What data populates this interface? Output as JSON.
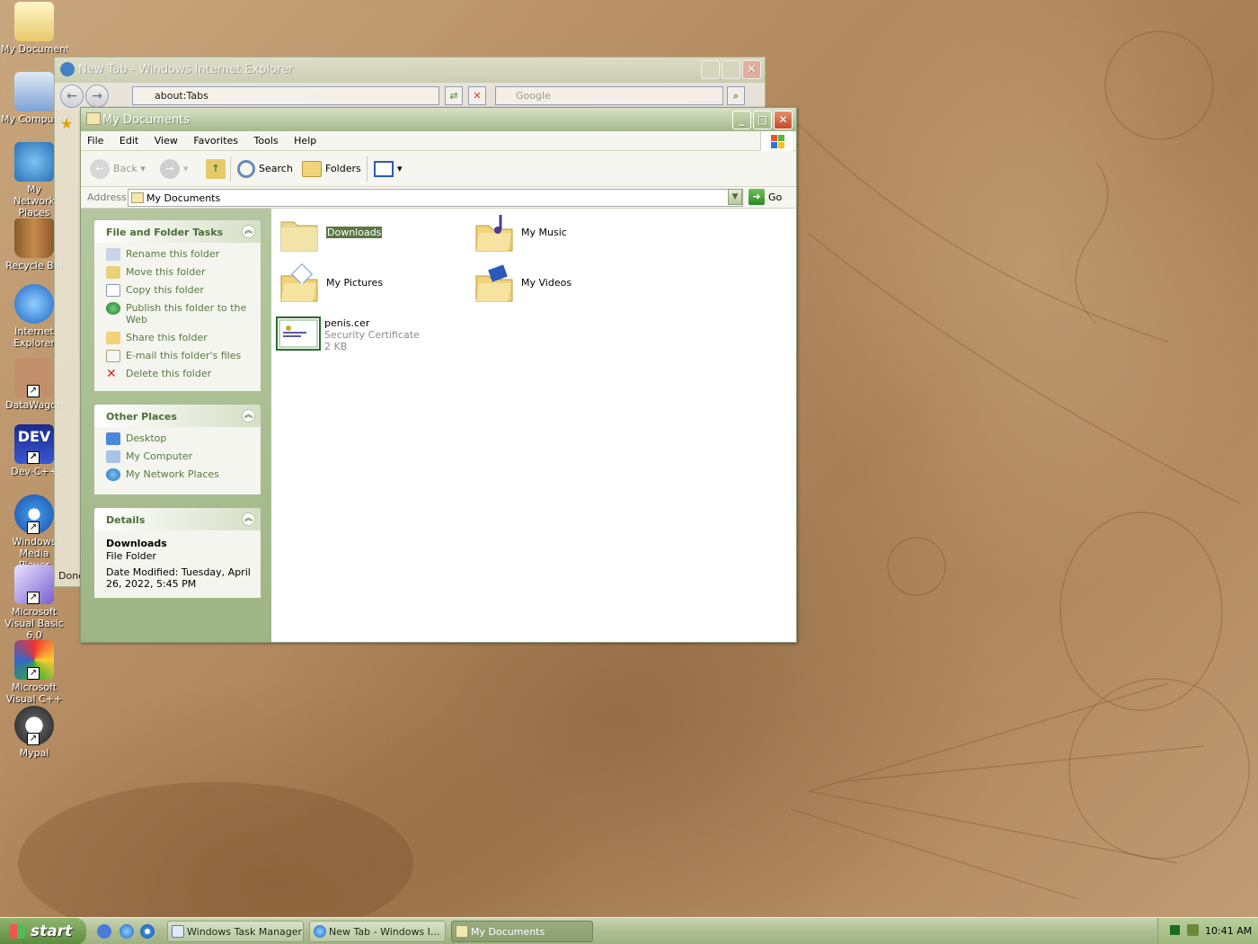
{
  "desktop": {
    "icons": [
      {
        "label": "My Documents",
        "icon": "my-documents-icon"
      },
      {
        "label": "My Computer",
        "icon": "my-computer-icon"
      },
      {
        "label": "My Network Places",
        "icon": "network-places-icon"
      },
      {
        "label": "Recycle Bin",
        "icon": "recycle-bin-icon"
      },
      {
        "label": "Internet Explorer",
        "icon": "internet-explorer-icon"
      },
      {
        "label": "DataWagon",
        "icon": "datawagon-icon"
      },
      {
        "label": "Dev-C++",
        "icon": "dev-cpp-icon"
      },
      {
        "label": "Windows Media Player",
        "icon": "media-player-icon"
      },
      {
        "label": "Microsoft Visual Basic 6.0",
        "icon": "visual-basic-icon"
      },
      {
        "label": "Microsoft Visual C++ 6.0",
        "icon": "visual-cpp-icon"
      },
      {
        "label": "Mypal",
        "icon": "mypal-icon"
      }
    ]
  },
  "ie_window": {
    "title": "New Tab - Windows Internet Explorer",
    "address": "about:Tabs",
    "search_placeholder": "Google",
    "status": "Done"
  },
  "mydocs": {
    "title": "My Documents",
    "menu": [
      "File",
      "Edit",
      "View",
      "Favorites",
      "Tools",
      "Help"
    ],
    "toolbar": {
      "back": "Back",
      "search": "Search",
      "folders": "Folders"
    },
    "address_label": "Address",
    "address_value": "My Documents",
    "go": "Go",
    "file_tasks": {
      "header": "File and Folder Tasks",
      "items": [
        "Rename this folder",
        "Move this folder",
        "Copy this folder",
        "Publish this folder to the Web",
        "Share this folder",
        "E-mail this folder's files",
        "Delete this folder"
      ]
    },
    "other_places": {
      "header": "Other Places",
      "items": [
        "Desktop",
        "My Computer",
        "My Network Places"
      ]
    },
    "details": {
      "header": "Details",
      "name": "Downloads",
      "type": "File Folder",
      "modified": "Date Modified: Tuesday, April 26, 2022, 5:45 PM"
    },
    "files": [
      {
        "name": "Downloads",
        "selected": true
      },
      {
        "name": "My Music"
      },
      {
        "name": "My Pictures"
      },
      {
        "name": "My Videos"
      },
      {
        "name": "penis.cer",
        "type": "Security Certificate",
        "size": "2 KB"
      }
    ]
  },
  "taskbar": {
    "start": "start",
    "buttons": [
      {
        "label": "Windows Task Manager"
      },
      {
        "label": "New Tab - Windows I..."
      },
      {
        "label": "My Documents",
        "active": true
      }
    ],
    "clock": "10:41 AM"
  },
  "colors": {
    "accent": "#5a7744",
    "taskbar": "#aebe92",
    "pane": "#a8bc8e"
  }
}
